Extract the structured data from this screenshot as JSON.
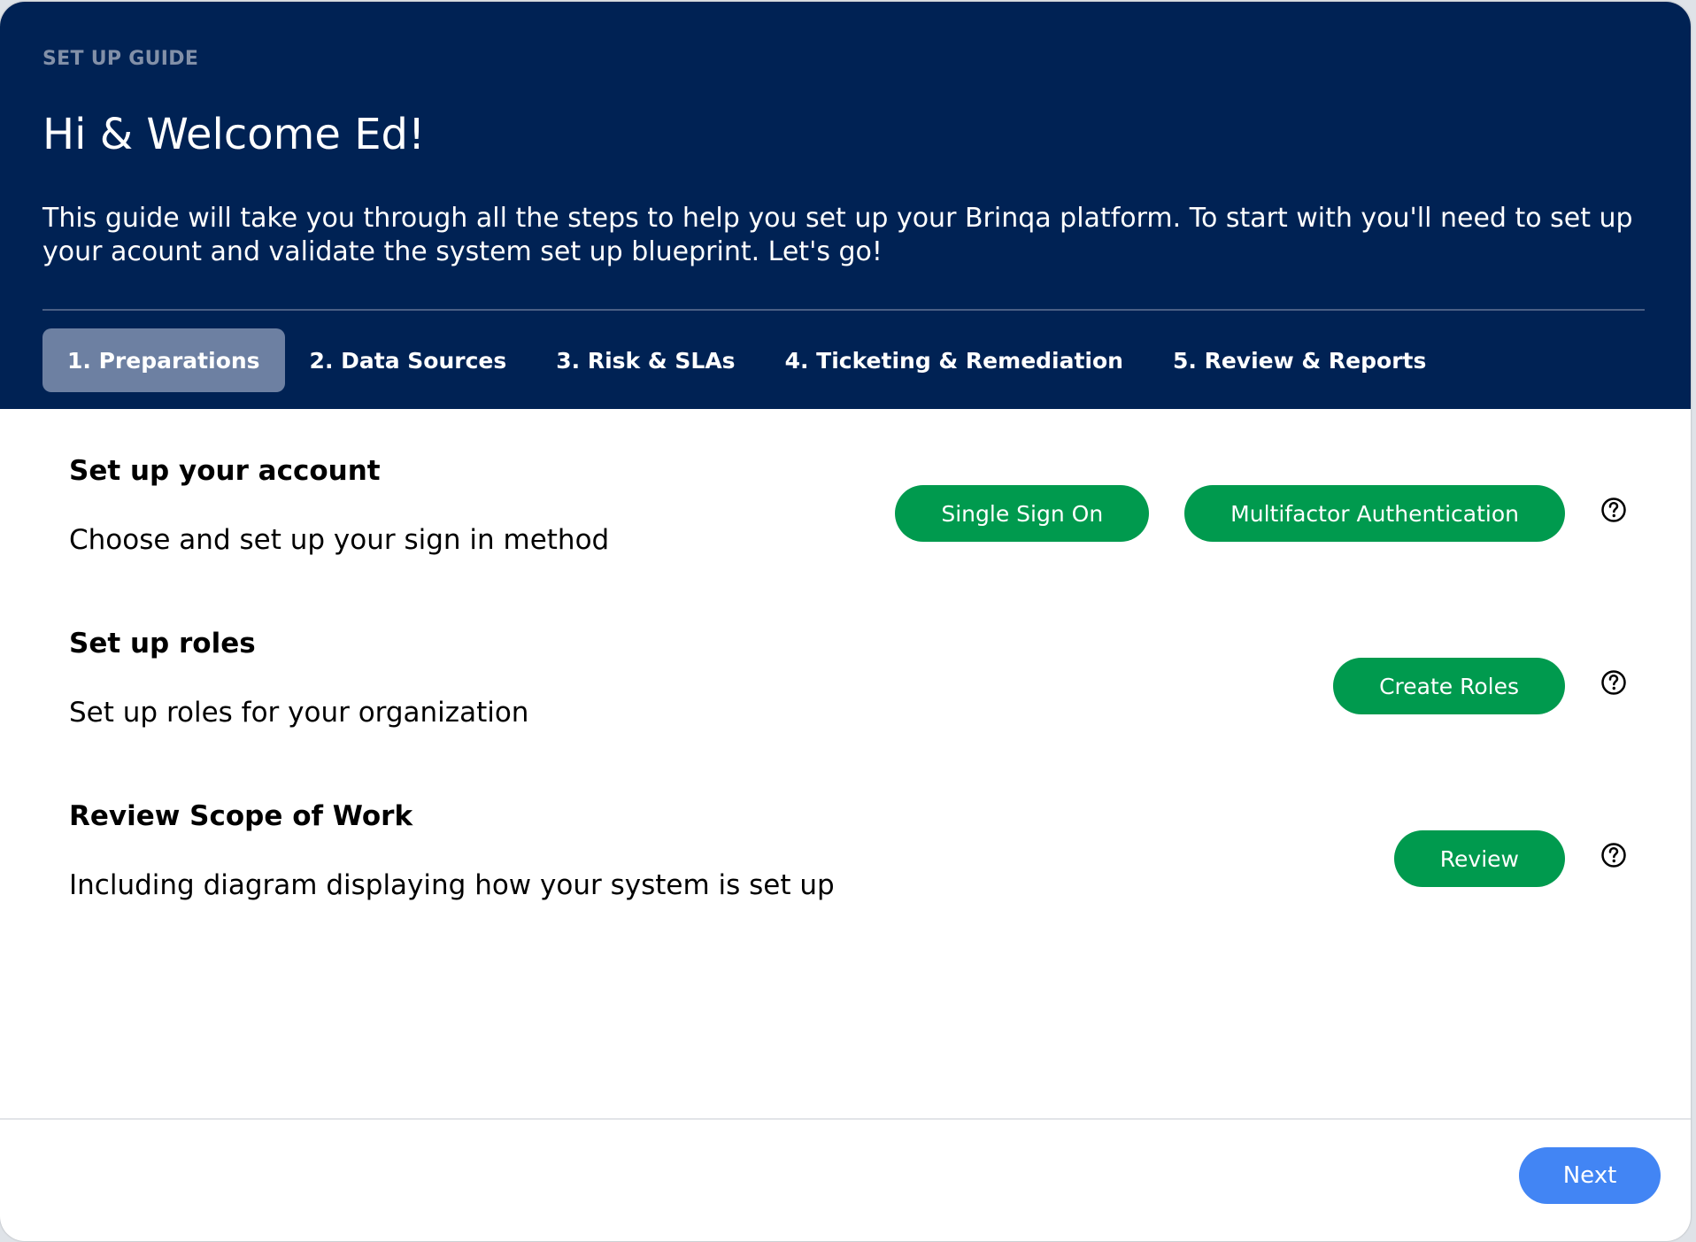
{
  "header": {
    "eyebrow": "SET UP GUIDE",
    "title": "Hi & Welcome Ed!",
    "intro": "This guide will take you through all the steps to help you set up your Brinqa platform. To start with you'll need to set up your acount and validate the system set up blueprint. Let's go!"
  },
  "tabs": [
    {
      "label": "1. Preparations",
      "active": true
    },
    {
      "label": "2. Data Sources",
      "active": false
    },
    {
      "label": "3. Risk & SLAs",
      "active": false
    },
    {
      "label": "4. Ticketing & Remediation",
      "active": false
    },
    {
      "label": "5. Review & Reports",
      "active": false
    }
  ],
  "sections": [
    {
      "title": "Set up your account",
      "description": "Choose and set up your sign in method",
      "buttons": [
        "Single Sign On",
        "Multifactor Authentication"
      ],
      "help_icon": "question-circle-icon"
    },
    {
      "title": "Set up roles",
      "description": "Set up roles for your organization",
      "buttons": [
        "Create Roles"
      ],
      "help_icon": "question-circle-icon"
    },
    {
      "title": "Review Scope of Work",
      "description": "Including diagram displaying how your system is set up",
      "buttons": [
        "Review"
      ],
      "help_icon": "question-circle-icon"
    }
  ],
  "footer": {
    "next_label": "Next"
  },
  "colors": {
    "header_bg": "#002254",
    "active_tab": "#6d80a2",
    "action_green": "#009a4e",
    "next_blue": "#4285f4"
  }
}
